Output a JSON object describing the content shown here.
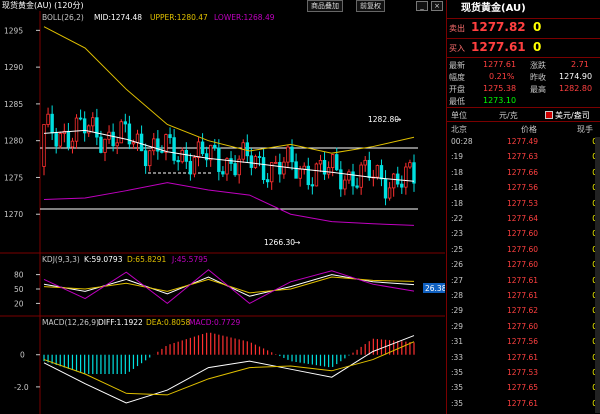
{
  "header": {
    "title": "现货黄金(AU) (120分)",
    "btn_product": "商品叠加",
    "btn_chart": "前复权",
    "win_min": "_",
    "win_close": "×"
  },
  "boll": {
    "label": "BOLL(26,2)",
    "mid": "MID:1274.48",
    "upper": "UPPER:1280.47",
    "lower": "LOWER:1268.49",
    "y_ticks": [
      "1295",
      "1290",
      "1285",
      "1280",
      "1275",
      "1270"
    ],
    "annot_high": "1282.80",
    "annot_low": "1266.30"
  },
  "kdj": {
    "label": "KDJ(9,3,3)",
    "k": "K:59.0793",
    "d": "D:65.8291",
    "j": "J:45.5795",
    "y_ticks": [
      "80",
      "50",
      "20"
    ],
    "current_badge": "26.38"
  },
  "macd": {
    "label": "MACD(12,26,9)",
    "diff": "DIFF:1.1922",
    "dea": "DEA:0.8058",
    "macd": "MACD:0.7729",
    "y_ticks": [
      "0",
      "-2.0"
    ]
  },
  "panel": {
    "title": "现货黄金(AU)",
    "sell_label": "卖出",
    "sell_price": "1277.82",
    "sell_qty": "0",
    "buy_label": "买入",
    "buy_price": "1277.61",
    "buy_qty": "0",
    "quotes": [
      {
        "l1": "最新",
        "v1": "1277.61",
        "l2": "涨跌",
        "v2": "2.71"
      },
      {
        "l1": "幅度",
        "v1": "0.21%",
        "l2": "昨收",
        "v2": "1274.90"
      },
      {
        "l1": "开盘",
        "v1": "1275.38",
        "l2": "最高",
        "v2": "1282.80"
      },
      {
        "l1": "最低",
        "v1": "1273.10",
        "l2": "",
        "v2": ""
      }
    ],
    "unit_label": "单位",
    "unit_value": "元/克",
    "unit_option": "美元/盎司",
    "col_city": "北京",
    "col_price": "价格",
    "col_vol": "现手",
    "ticks": [
      {
        "t": "00:28",
        "p": "1277.49",
        "v": "0"
      },
      {
        "t": ":19",
        "p": "1277.63",
        "v": "0"
      },
      {
        "t": ":18",
        "p": "1277.66",
        "v": "0"
      },
      {
        "t": ":18",
        "p": "1277.56",
        "v": "0"
      },
      {
        "t": ":18",
        "p": "1277.53",
        "v": "0"
      },
      {
        "t": ":22",
        "p": "1277.64",
        "v": "0"
      },
      {
        "t": ":23",
        "p": "1277.60",
        "v": "0"
      },
      {
        "t": ":25",
        "p": "1277.60",
        "v": "0"
      },
      {
        "t": ":26",
        "p": "1277.60",
        "v": "0"
      },
      {
        "t": ":27",
        "p": "1277.61",
        "v": "0"
      },
      {
        "t": ":28",
        "p": "1277.61",
        "v": "0"
      },
      {
        "t": ":29",
        "p": "1277.62",
        "v": "0"
      },
      {
        "t": ":29",
        "p": "1277.60",
        "v": "0"
      },
      {
        "t": ":31",
        "p": "1277.56",
        "v": "0"
      },
      {
        "t": ":33",
        "p": "1277.61",
        "v": "0"
      },
      {
        "t": ":35",
        "p": "1277.53",
        "v": "0"
      },
      {
        "t": ":35",
        "p": "1277.65",
        "v": "0"
      },
      {
        "t": ":35",
        "p": "1277.61",
        "v": "0"
      }
    ]
  },
  "colors": {
    "up": "#ff3030",
    "down": "#00e0e0",
    "mid": "#ffffff",
    "upper": "#e0c000",
    "lower": "#c000c0",
    "k": "#ffffff",
    "d": "#e0c000",
    "j": "#c000c0",
    "grid": "#7a0000"
  },
  "chart_data": [
    {
      "type": "candlestick",
      "title": "",
      "y_ticks": [
        1295,
        1290,
        1285,
        1280,
        1275,
        1270
      ],
      "ylim": [
        1265,
        1296
      ],
      "hlines": [
        1279.0,
        1270.8
      ],
      "annotations": [
        {
          "label": "1282.80",
          "value": 1282.8
        },
        {
          "label": "1266.30",
          "value": 1266.3
        }
      ],
      "series": [
        {
          "name": "MID",
          "values": [
            1281.0,
            1281.4,
            1280.2,
            1278.5,
            1277.6,
            1277.0,
            1276.3,
            1275.7,
            1275.0,
            1274.48
          ]
        },
        {
          "name": "UPPER",
          "values": [
            1295.5,
            1292.6,
            1287.0,
            1282.2,
            1280.0,
            1278.6,
            1279.5,
            1278.3,
            1279.2,
            1280.47
          ]
        },
        {
          "name": "LOWER",
          "values": [
            1272.0,
            1272.2,
            1273.2,
            1274.3,
            1273.3,
            1272.6,
            1270.0,
            1269.0,
            1268.7,
            1268.49
          ]
        }
      ]
    },
    {
      "type": "line",
      "title": "",
      "y_ticks": [
        80,
        50,
        20
      ],
      "ylim": [
        0,
        100
      ],
      "series": [
        {
          "name": "K",
          "values": [
            60,
            45,
            70,
            40,
            75,
            35,
            55,
            80,
            65,
            59.08
          ]
        },
        {
          "name": "D",
          "values": [
            55,
            50,
            62,
            45,
            70,
            42,
            50,
            75,
            68,
            65.83
          ]
        },
        {
          "name": "J",
          "values": [
            70,
            30,
            85,
            20,
            90,
            20,
            65,
            88,
            60,
            45.58
          ]
        }
      ]
    },
    {
      "type": "bar",
      "title": "",
      "y_ticks": [
        0,
        -2.0
      ],
      "ylim": [
        -3.5,
        1.6
      ],
      "series": [
        {
          "name": "DIFF",
          "values": [
            -0.5,
            -1.8,
            -3.0,
            -2.2,
            -0.8,
            -0.4,
            -0.9,
            -1.4,
            0.2,
            1.19
          ]
        },
        {
          "name": "DEA",
          "values": [
            -0.3,
            -1.2,
            -2.4,
            -2.5,
            -1.5,
            -0.8,
            -0.7,
            -1.0,
            -0.3,
            0.81
          ]
        },
        {
          "name": "MACD",
          "values": [
            -0.4,
            -1.2,
            -1.2,
            0.6,
            1.4,
            0.8,
            -0.4,
            -0.8,
            1.0,
            0.77
          ]
        }
      ]
    }
  ]
}
